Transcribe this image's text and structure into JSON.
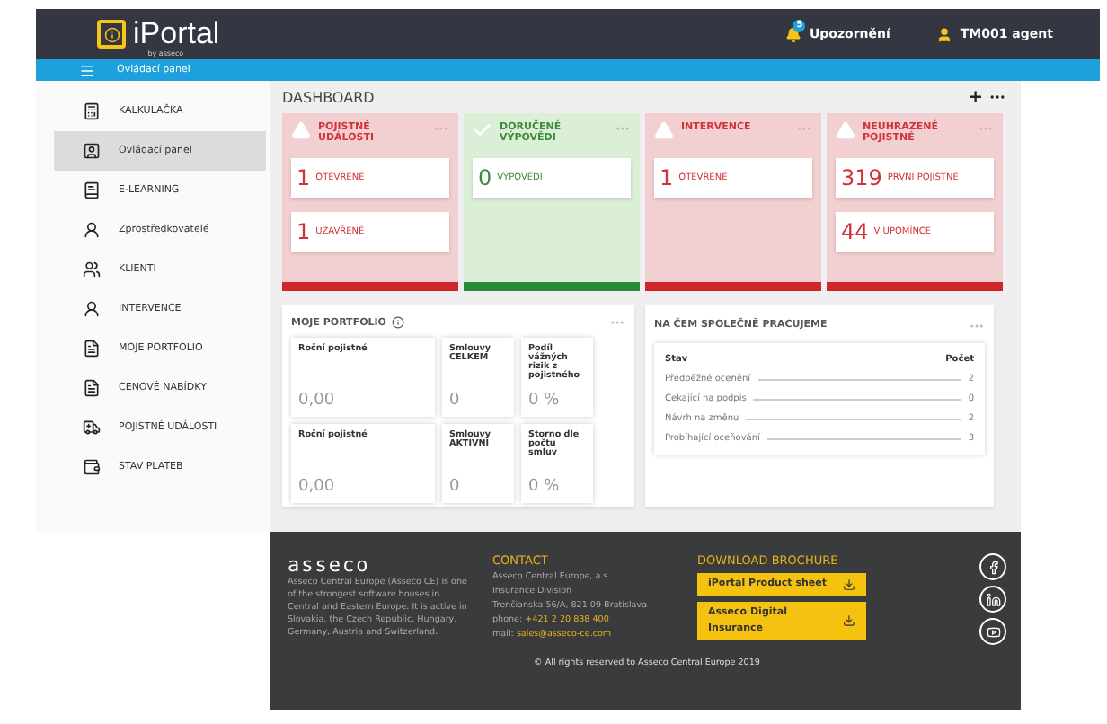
{
  "header": {
    "logo": "iPortal",
    "logo_sub": "by asseco",
    "notifications": {
      "label": "Upozornění",
      "count": "5"
    },
    "user": "TM001 agent"
  },
  "nav_bar": {
    "title": "Ovládací panel"
  },
  "sidebar": {
    "items": [
      {
        "label": "KALKULAČKA",
        "selected": false
      },
      {
        "label": "Ovládací panel",
        "selected": true
      },
      {
        "label": "E-LEARNING",
        "selected": false
      },
      {
        "label": "Zprostředkovatelé",
        "selected": false
      },
      {
        "label": "KLIENTI",
        "selected": false
      },
      {
        "label": "INTERVENCE",
        "selected": false
      },
      {
        "label": "MOJE PORTFOLIO",
        "selected": false
      },
      {
        "label": "CENOVÉ NABÍDKY",
        "selected": false
      },
      {
        "label": "POJISTNÉ UDÁLOSTI",
        "selected": false
      },
      {
        "label": "STAV PLATEB",
        "selected": false
      }
    ]
  },
  "dashboard": {
    "title": "DASHBOARD",
    "add": "+",
    "tiles": [
      {
        "kind": "alert",
        "title": "POJISTNÉ UDÁLOSTI",
        "counts": [
          {
            "value": "1",
            "label": "OTEVŘENÉ"
          },
          {
            "value": "1",
            "label": "UZAVŘENÉ"
          }
        ]
      },
      {
        "kind": "ok",
        "title": "DORUČENÉ VÝPOVĚDI",
        "counts": [
          {
            "value": "0",
            "label": "VÝPOVĚDI"
          }
        ]
      },
      {
        "kind": "alert",
        "title": "INTERVENCE",
        "counts": [
          {
            "value": "1",
            "label": "OTEVŘENÉ"
          }
        ]
      },
      {
        "kind": "alert",
        "title": "NEUHRAZENÉ POJISTNÉ",
        "counts": [
          {
            "value": "319",
            "label": "PRVNÍ POJISTNÉ"
          },
          {
            "value": "44",
            "label": "V UPOMÍNCE"
          }
        ]
      }
    ],
    "portfolio": {
      "title": "MOJE PORTFOLIO",
      "cards": [
        {
          "label": "Roční pojistné",
          "value": "0,00",
          "kind": "wide"
        },
        {
          "label": "Smlouvy CELKEM",
          "value": "0",
          "kind": "narrow"
        },
        {
          "label": "Podíl vážných rizik z pojistného",
          "value": "0 %",
          "kind": "mid"
        },
        {
          "label": "Roční pojistné",
          "value": "0,00",
          "kind": "wide"
        },
        {
          "label": "Smlouvy AKTIVNÍ",
          "value": "0",
          "kind": "narrow"
        },
        {
          "label": "Storno dle počtu smluv",
          "value": "0 %",
          "kind": "mid"
        }
      ]
    },
    "work": {
      "title": "NA ČEM SPOLEČNĚ PRACUJEME",
      "columns": [
        "Stav",
        "Počet"
      ],
      "rows": [
        {
          "label": "Předběžné ocenění",
          "count": "2"
        },
        {
          "label": "Čekající na podpis",
          "count": "0"
        },
        {
          "label": "Návrh na změnu",
          "count": "2"
        },
        {
          "label": "Probíhající oceňování",
          "count": "3"
        }
      ]
    }
  },
  "footer": {
    "brand": "asseco",
    "about": "Asseco Central Europe (Asseco CE) is one of the strongest software houses in Central and Eastern Europe. It is active in Slovakia, the Czech Republic, Hungary, Germany, Austria and Switzerland.",
    "contact_title": "CONTACT",
    "contact_lines": [
      "Asseco Central Europe, a.s.",
      "Insurance Division",
      "Trenčianska 56/A, 821 09 Bratislava"
    ],
    "phone_label": "phone:",
    "phone": "+421 2 20 838 400",
    "mail_label": "mail:",
    "mail": "sales@asseco-ce.com",
    "download_title": "DOWNLOAD BROCHURE",
    "brochures": [
      "iPortal Product sheet",
      "Asseco Digital Insurance"
    ],
    "copyright": "© All rights reserved to Asseco Central Europe 2019"
  }
}
